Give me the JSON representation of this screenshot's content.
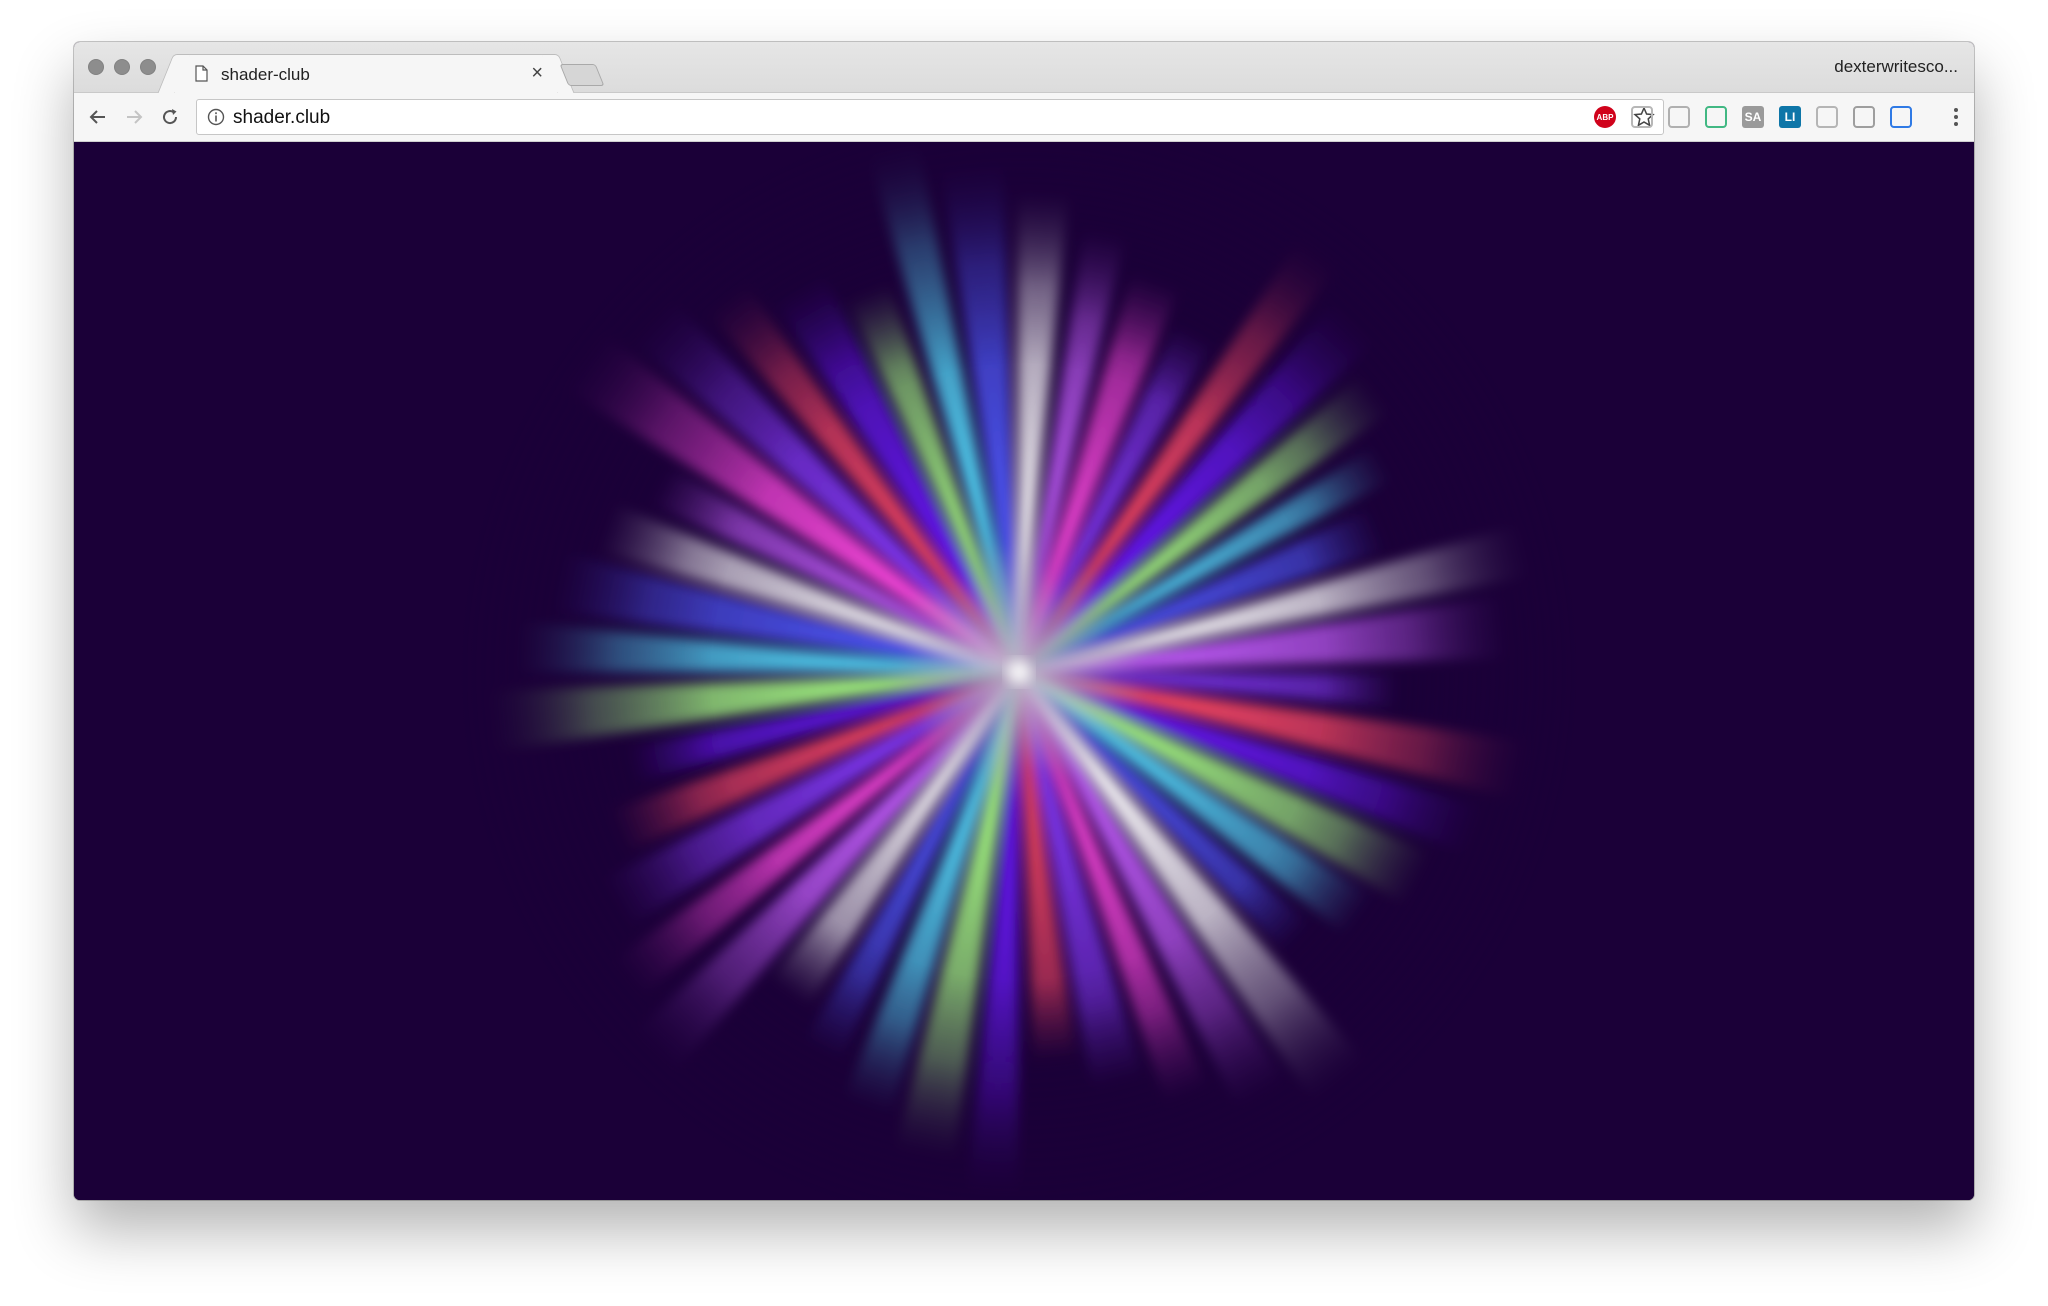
{
  "browser": {
    "tab_title": "shader-club",
    "tab_close": "×",
    "profile_name": "dexterwritesco...",
    "url": "shader.club",
    "extensions": [
      {
        "name": "adblock-plus-icon",
        "label": "ABP",
        "color": "#d0021b"
      },
      {
        "name": "speech-bubble-extension-icon",
        "label": "",
        "color": "#b7b7b7"
      },
      {
        "name": "code-brackets-extension-icon",
        "label": "",
        "color": "#b0b0b0"
      },
      {
        "name": "vue-devtools-icon",
        "label": "",
        "color": "#41b883"
      },
      {
        "name": "sa-extension-icon",
        "label": "SA",
        "color": "#9a9a9a"
      },
      {
        "name": "linkedin-extension-icon",
        "label": "LI",
        "color": "#0e76a8"
      },
      {
        "name": "react-devtools-icon",
        "label": "",
        "color": "#b5b5b5"
      },
      {
        "name": "reader-extension-icon",
        "label": "",
        "color": "#9e9e9e"
      },
      {
        "name": "cast-icon",
        "label": "",
        "color": "#2f7ae5"
      }
    ]
  },
  "canvas": {
    "background": "#1b0038",
    "palette": [
      "#7a3cff",
      "#5a1aff",
      "#40e0ff",
      "#ffffff",
      "#ff49d8",
      "#ff4a3a",
      "#9dff60",
      "#3a5bff",
      "#c060ff"
    ]
  }
}
